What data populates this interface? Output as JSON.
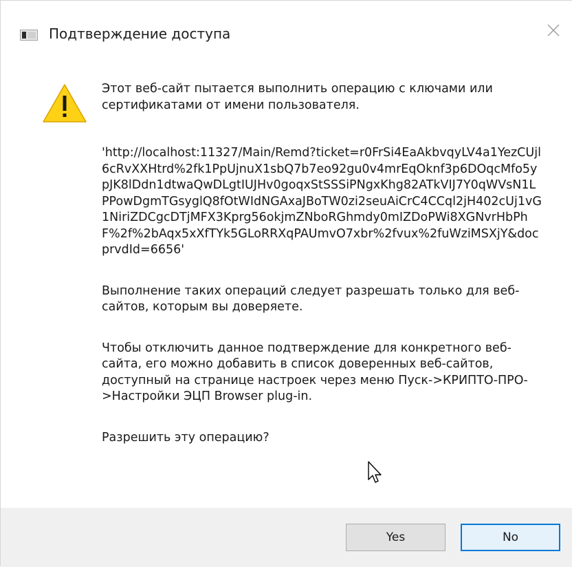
{
  "window": {
    "title": "Подтверждение доступа",
    "close_icon": "close-icon"
  },
  "message": {
    "warning_icon": "warning-icon",
    "intro": "Этот веб-сайт пытается выполнить операцию с ключами или сертификатами от имени пользователя.",
    "url": "'http://localhost:11327/Main/Remd?ticket=r0FrSi4EaAkbvqyLV4a1YezCUjl6cRvXXHtrd%2fk1PpUjnuX1sbQ7b7eo92gu0v4mrEqOknf3p6DOqcMfo5ypJK8lDdn1dtwaQwDLgtIUJHv0goqxStSSSiPNgxKhg82ATkVIJ7Y0qWVsN1LPPowDgmTGsyglQ8fOtWIdNGAxaJBoTW0zi2seuAiCrC4CCql2jH402cUj1vG1NiriZDCgcDTjMFX3Kprg56okjmZNboRGhmdy0mIZDoPWi8XGNvrHbPhF%2f%2bAqx5xXfTYk5GLoRRXqPAUmvO7xbr%2fvux%2fuWziMSXjY&docprvdId=6656'",
    "trust_note": "Выполнение таких операций следует разрешать только для веб-сайтов, которым вы доверяете.",
    "disable_hint": "Чтобы отключить данное подтверждение для конкретного веб-сайта, его можно добавить в список доверенных веб-сайтов, доступный на странице настроек через меню Пуск->КРИПТО-ПРО->Настройки ЭЦП Browser plug-in.",
    "question": "Разрешить эту операцию?"
  },
  "buttons": {
    "yes_label": "Yes",
    "no_label": "No"
  },
  "colors": {
    "footer_bg": "#f0f0f0",
    "default_button_border": "#0078d7",
    "warning_yellow": "#fcd116"
  }
}
